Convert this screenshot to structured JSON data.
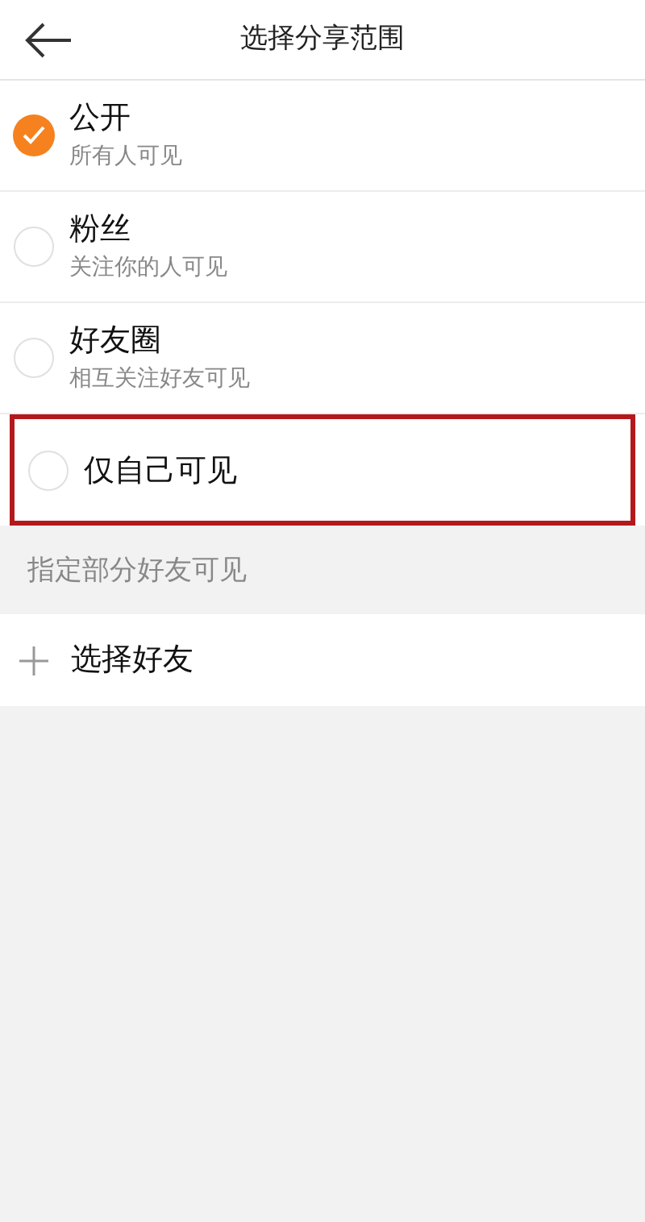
{
  "header": {
    "title": "选择分享范围"
  },
  "options": [
    {
      "label": "公开",
      "description": "所有人可见",
      "selected": true,
      "highlighted": false
    },
    {
      "label": "粉丝",
      "description": "关注你的人可见",
      "selected": false,
      "highlighted": false
    },
    {
      "label": "好友圈",
      "description": "相互关注好友可见",
      "selected": false,
      "highlighted": false
    },
    {
      "label": "仅自己可见",
      "selected": false,
      "highlighted": true
    }
  ],
  "section": {
    "title": "指定部分好友可见"
  },
  "add_friend": {
    "label": "选择好友"
  }
}
